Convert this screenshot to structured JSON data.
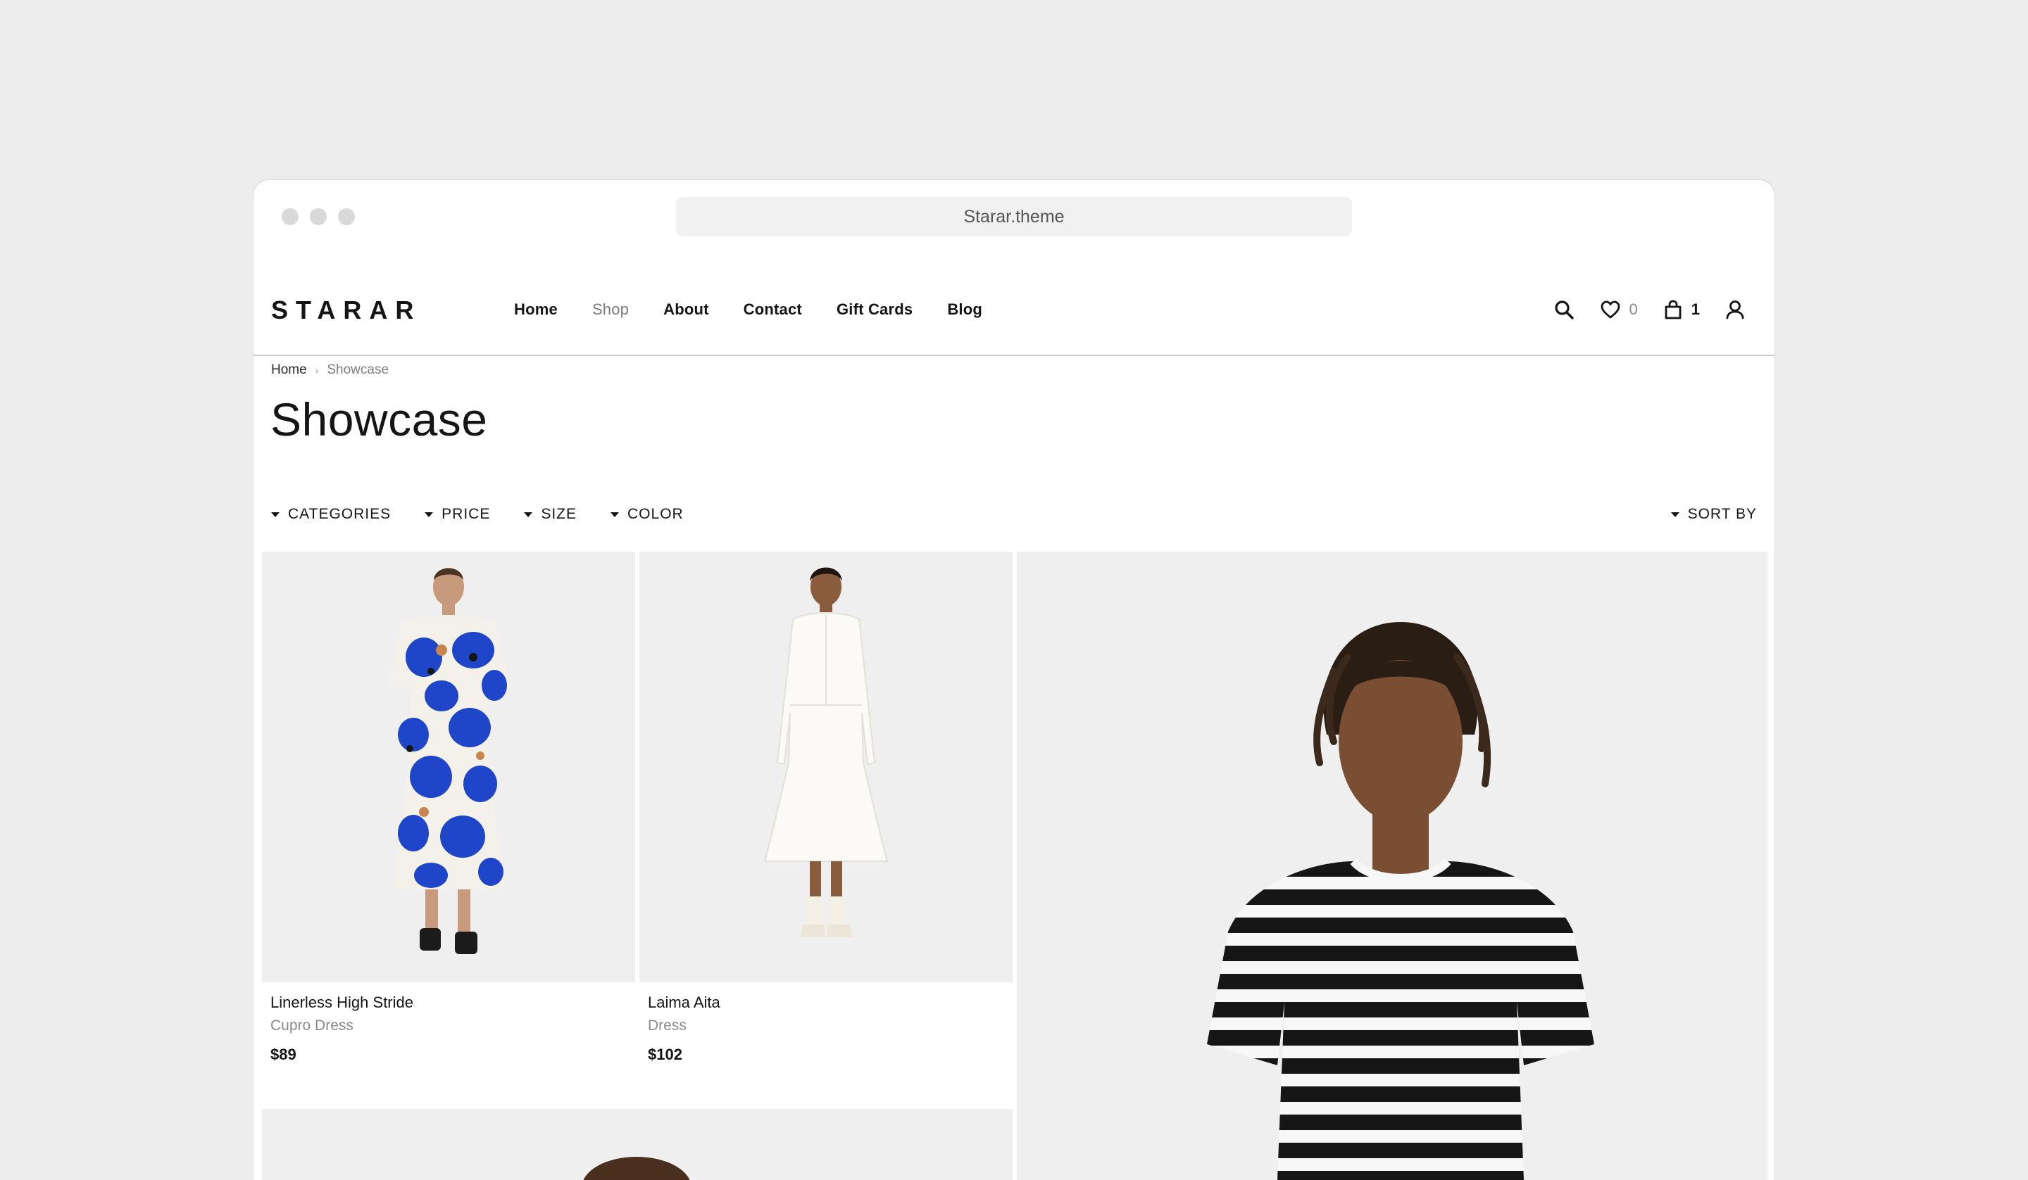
{
  "browser": {
    "url": "Starar.theme"
  },
  "brand": {
    "logo": "STARAR"
  },
  "nav": {
    "items": [
      "Home",
      "Shop",
      "About",
      "Contact",
      "Gift Cards",
      "Blog"
    ]
  },
  "header_tools": {
    "wishlist_count": "0",
    "cart_count": "1"
  },
  "breadcrumb": {
    "home": "Home",
    "current": "Showcase"
  },
  "page": {
    "title": "Showcase"
  },
  "filters": {
    "categories": "CATEGORIES",
    "price": "PRICE",
    "size": "SIZE",
    "color": "COLOR",
    "sort": "SORT BY"
  },
  "products": [
    {
      "name": "Linerless High Stride",
      "category": "Cupro Dress",
      "price": "$89"
    },
    {
      "name": "Laima Aita",
      "category": "Dress",
      "price": "$102"
    }
  ],
  "colors": {
    "accent": "#151515",
    "dress_pattern": "#1f45c8",
    "page_bg": "#ededed"
  }
}
